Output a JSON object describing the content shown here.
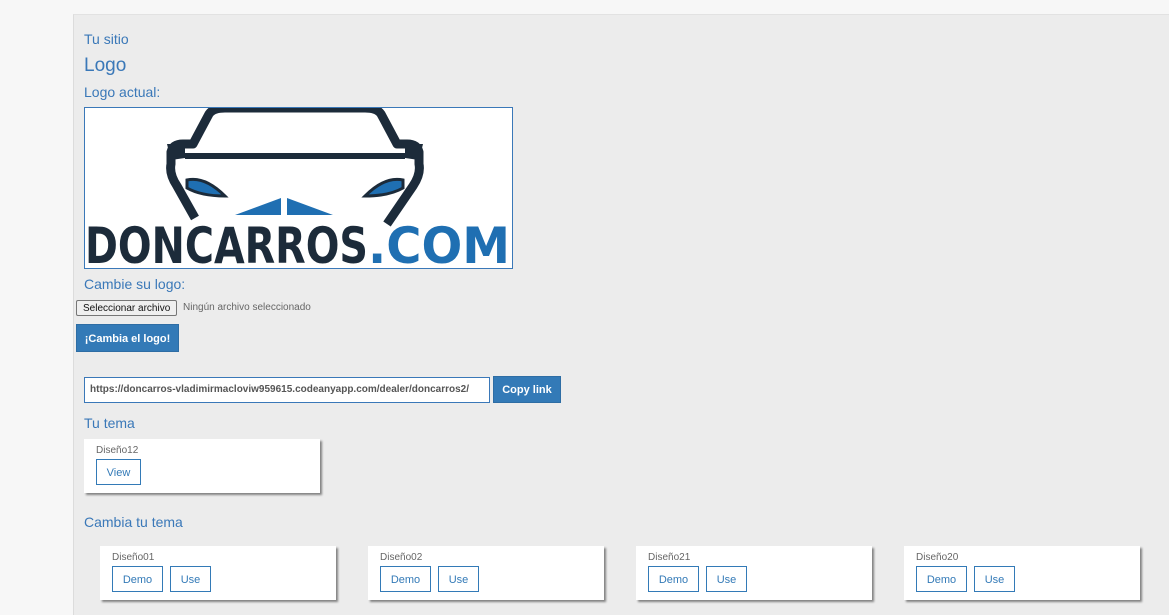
{
  "site": {
    "title": "Tu sitio"
  },
  "logo_section": {
    "heading": "Logo",
    "current_label": "Logo actual:",
    "logo_text_dark": "DONCARROS",
    "logo_text_blue": ".COM",
    "change_label": "Cambie su logo:",
    "file_button": "Seleccionar archivo",
    "file_status": "Ningún archivo seleccionado",
    "submit_label": "¡Cambia el logo!"
  },
  "link": {
    "url": "https://doncarros-vladimirmacloviw959615.codeanyapp.com/dealer/doncarros2/",
    "copy_label": "Copy link"
  },
  "current_theme": {
    "heading": "Tu tema",
    "name": "Diseño12",
    "view_label": "View"
  },
  "themes": {
    "heading": "Cambia tu tema",
    "items": [
      {
        "name": "Diseño01",
        "demo_label": "Demo",
        "use_label": "Use"
      },
      {
        "name": "Diseño02",
        "demo_label": "Demo",
        "use_label": "Use"
      },
      {
        "name": "Diseño21",
        "demo_label": "Demo",
        "use_label": "Use"
      },
      {
        "name": "Diseño20",
        "demo_label": "Demo",
        "use_label": "Use"
      }
    ]
  },
  "colors": {
    "accent": "#337ab7",
    "logo_dark": "#1c2b3a",
    "logo_blue": "#1f6fb2"
  }
}
